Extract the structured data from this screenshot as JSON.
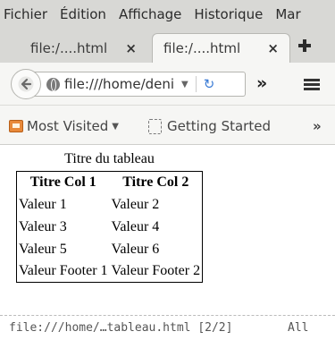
{
  "menubar": {
    "items": [
      {
        "label": "Fichier"
      },
      {
        "label": "Édition"
      },
      {
        "label": "Affichage"
      },
      {
        "label": "Historique"
      },
      {
        "label": "Mar"
      }
    ]
  },
  "tabs": [
    {
      "title": "file:/....html",
      "close": "×",
      "active": false
    },
    {
      "title": "file:/....html",
      "close": "×",
      "active": true
    }
  ],
  "navbar": {
    "url": "file:///home/deni",
    "overflow": "»"
  },
  "bookmarks": {
    "most_visited": "Most Visited",
    "getting_started": "Getting Started",
    "more": "»"
  },
  "table": {
    "caption": "Titre du tableau",
    "headers": [
      "Titre Col 1",
      "Titre Col 2"
    ],
    "rows": [
      [
        "Valeur 1",
        "Valeur 2"
      ],
      [
        "Valeur 3",
        "Valeur 4"
      ],
      [
        "Valeur 5",
        "Valeur 6"
      ]
    ],
    "footer": [
      "Valeur Footer 1",
      "Valeur Footer 2"
    ]
  },
  "statusbar": {
    "path": "file:///home/…tableau.html [2/2]",
    "mode": "All"
  },
  "colors": {
    "chrome_bg": "#d8d8d5",
    "toolbar_bg": "#f6f6f4",
    "reload_blue": "#3a7bd5",
    "folder_orange": "#e8893a"
  }
}
